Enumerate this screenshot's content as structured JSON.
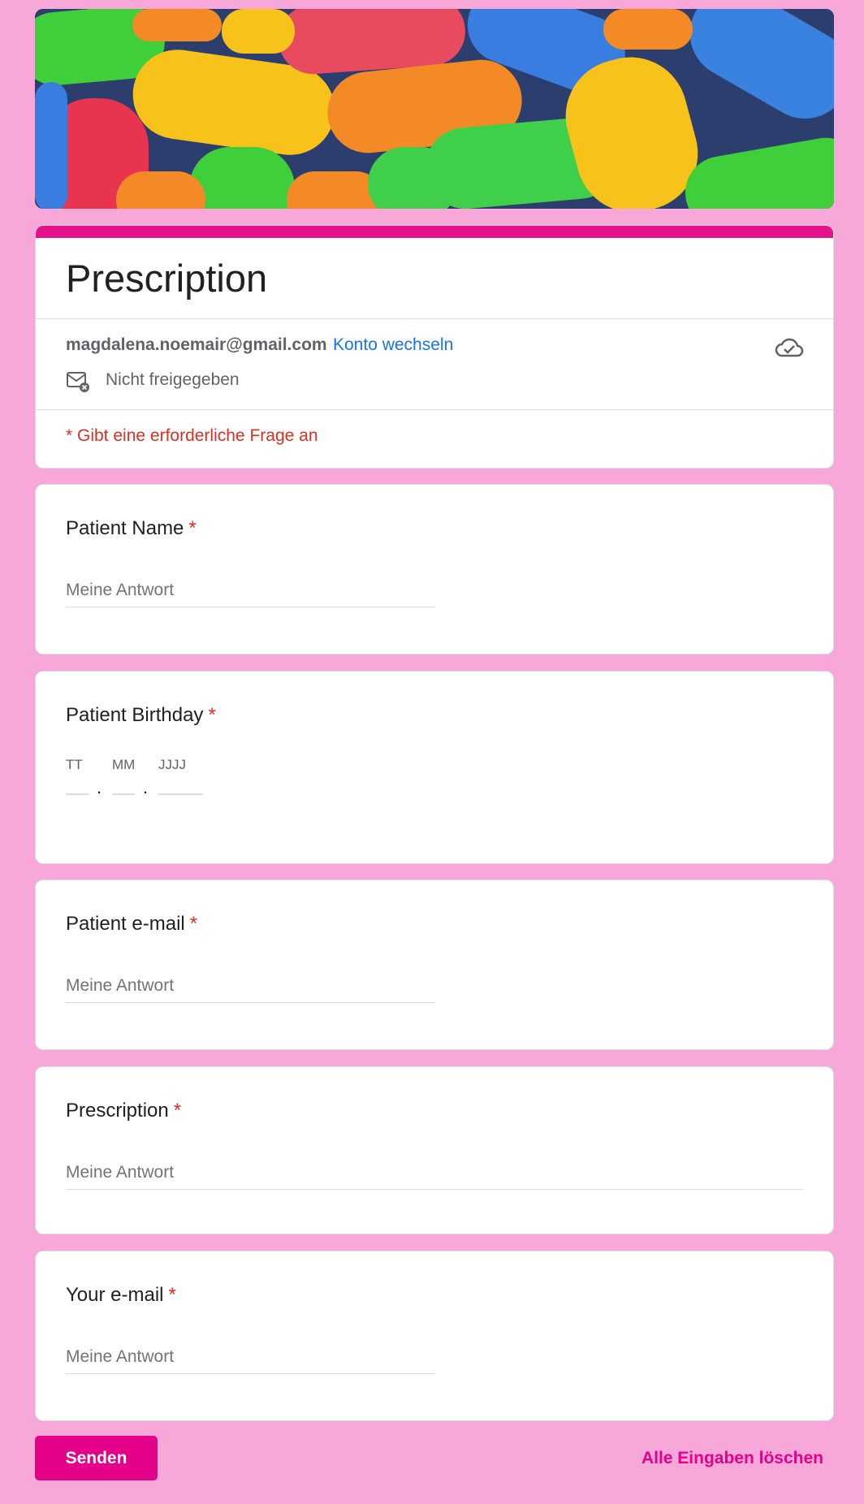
{
  "form": {
    "title": "Prescription",
    "accent_color": "#e5128c",
    "background_color": "#f7a8d8"
  },
  "account": {
    "email": "magdalena.noemair@gmail.com",
    "switch_label": "Konto wechseln",
    "sharing_status": "Nicht freigegeben"
  },
  "required_note": "* Gibt eine erforderliche Frage an",
  "questions": {
    "patient_name": {
      "label": "Patient Name",
      "required_mark": "*",
      "placeholder": "Meine Antwort"
    },
    "patient_birthday": {
      "label": "Patient Birthday",
      "required_mark": "*",
      "day_label": "TT",
      "month_label": "MM",
      "year_label": "JJJJ",
      "separator": "."
    },
    "patient_email": {
      "label": "Patient e-mail",
      "required_mark": "*",
      "placeholder": "Meine Antwort"
    },
    "prescription": {
      "label": "Prescription",
      "required_mark": "*",
      "placeholder": "Meine Antwort"
    },
    "your_email": {
      "label": "Your e-mail",
      "required_mark": "*",
      "placeholder": "Meine Antwort"
    }
  },
  "actions": {
    "submit_label": "Senden",
    "clear_label": "Alle Eingaben löschen"
  }
}
